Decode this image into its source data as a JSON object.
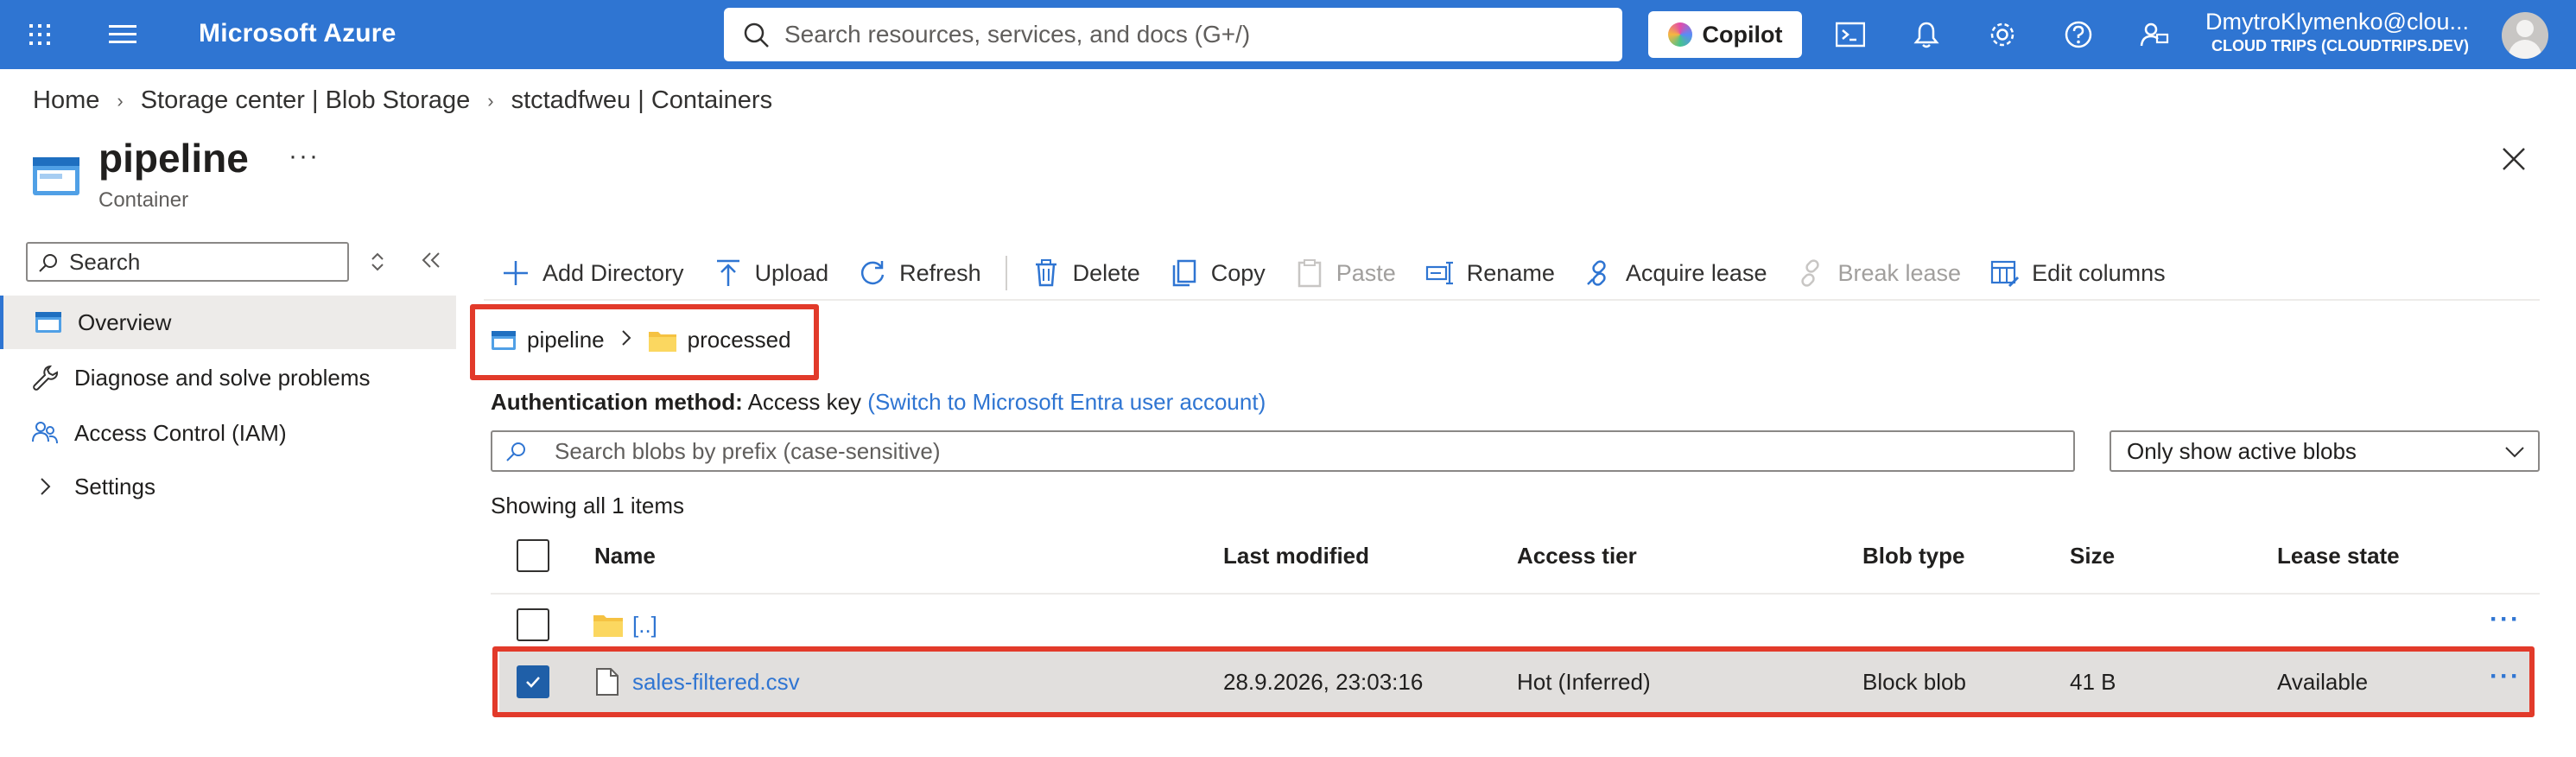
{
  "topbar": {
    "brand": "Microsoft Azure",
    "search_placeholder": "Search resources, services, and docs (G+/)",
    "copilot_label": "Copilot",
    "user_name": "DmytroKlymenko@clou...",
    "user_org": "CLOUD TRIPS (CLOUDTRIPS.DEV)",
    "accent": "#2f75d2"
  },
  "breadcrumb": [
    "Home",
    "Storage center | Blob Storage",
    "stctadfweu | Containers"
  ],
  "header": {
    "title": "pipeline",
    "subtitle": "Container",
    "more": "···"
  },
  "nav": {
    "search_placeholder": "Search",
    "items": [
      {
        "label": "Overview",
        "icon": "container-icon",
        "active": true
      },
      {
        "label": "Diagnose and solve problems",
        "icon": "wrench-icon"
      },
      {
        "label": "Access Control (IAM)",
        "icon": "people-icon"
      },
      {
        "label": "Settings",
        "icon": "chevron-right-icon"
      }
    ]
  },
  "toolbar": {
    "add_directory": "Add Directory",
    "upload": "Upload",
    "refresh": "Refresh",
    "delete": "Delete",
    "copy": "Copy",
    "paste": "Paste",
    "rename": "Rename",
    "acquire_lease": "Acquire lease",
    "break_lease": "Break lease",
    "edit_columns": "Edit columns"
  },
  "path": {
    "container": "pipeline",
    "folder": "processed"
  },
  "auth": {
    "label": "Authentication method:",
    "value": "Access key",
    "switch_link": "(Switch to Microsoft Entra user account)"
  },
  "blob_search_placeholder": "Search blobs by prefix (case-sensitive)",
  "filter_value": "Only show active blobs",
  "count_text": "Showing all 1 items",
  "table": {
    "columns": [
      "Name",
      "Last modified",
      "Access tier",
      "Blob type",
      "Size",
      "Lease state"
    ],
    "parent_row": {
      "name": "[..]"
    },
    "rows": [
      {
        "name": "sales-filtered.csv",
        "last_modified": "28.9.2026, 23:03:16",
        "access_tier": "Hot (Inferred)",
        "blob_type": "Block blob",
        "size": "41 B",
        "lease_state": "Available",
        "selected": true
      }
    ],
    "row_more": "···"
  },
  "highlight_color": "#e23a2a"
}
